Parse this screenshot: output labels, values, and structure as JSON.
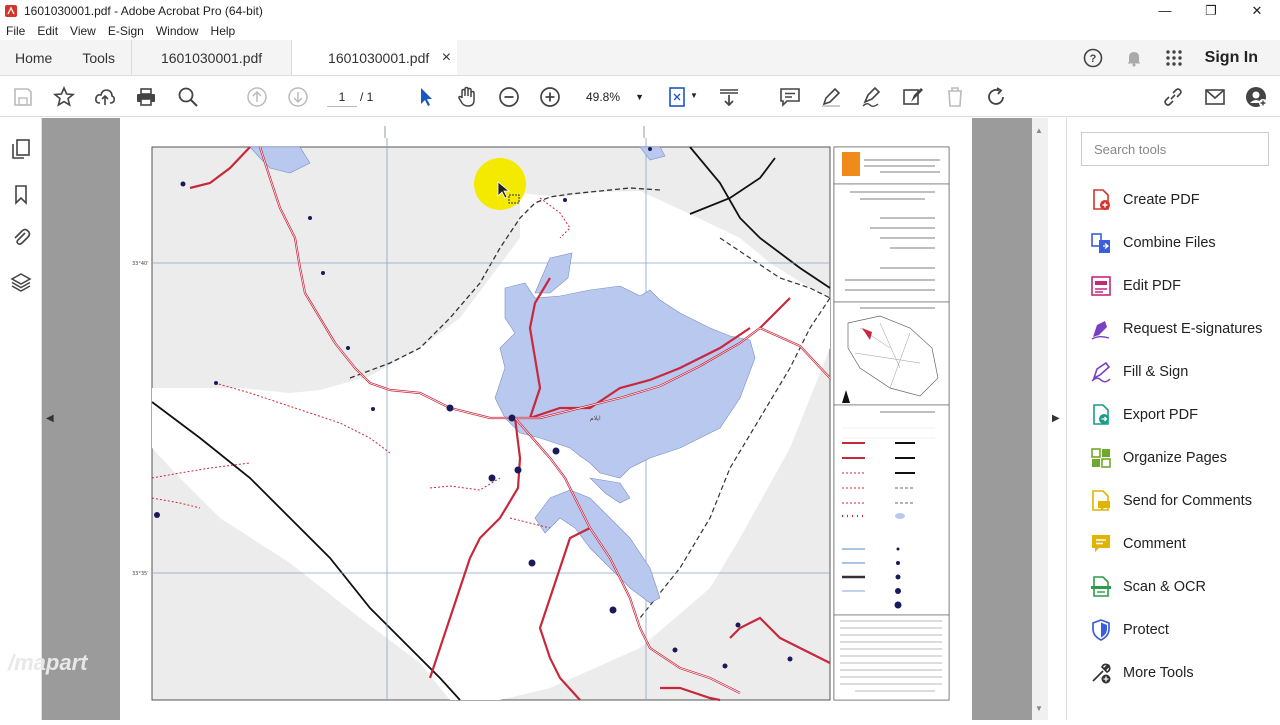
{
  "window": {
    "title": "1601030001.pdf - Adobe Acrobat Pro (64-bit)",
    "controls": [
      "—",
      "❐",
      "✕"
    ]
  },
  "menu": [
    "File",
    "Edit",
    "View",
    "E-Sign",
    "Window",
    "Help"
  ],
  "tabs": {
    "home": "Home",
    "tools": "Tools",
    "doc1": "1601030001.pdf",
    "doc2": "1601030001.pdf",
    "close": "×",
    "signin": "Sign In"
  },
  "toolbar": {
    "page_current": "1",
    "page_total": "/  1",
    "zoom": "49.8%"
  },
  "right_panel": {
    "search_placeholder": "Search tools",
    "tools": [
      {
        "label": "Create PDF",
        "color": "#d4342c",
        "icon": "create-pdf-icon"
      },
      {
        "label": "Combine Files",
        "color": "#3b5fd9",
        "icon": "combine-files-icon"
      },
      {
        "label": "Edit PDF",
        "color": "#c4287a",
        "icon": "edit-pdf-icon"
      },
      {
        "label": "Request E-signatures",
        "color": "#7b3fc4",
        "icon": "request-esign-icon"
      },
      {
        "label": "Fill & Sign",
        "color": "#7b3fc4",
        "icon": "fill-sign-icon"
      },
      {
        "label": "Export PDF",
        "color": "#1b9a8a",
        "icon": "export-pdf-icon"
      },
      {
        "label": "Organize Pages",
        "color": "#6fa82c",
        "icon": "organize-pages-icon"
      },
      {
        "label": "Send for Comments",
        "color": "#e0b400",
        "icon": "send-comments-icon"
      },
      {
        "label": "Comment",
        "color": "#e0b400",
        "icon": "comment-icon"
      },
      {
        "label": "Scan & OCR",
        "color": "#2d9b4a",
        "icon": "scan-ocr-icon"
      },
      {
        "label": "Protect",
        "color": "#3b5fd9",
        "icon": "protect-icon"
      },
      {
        "label": "More Tools",
        "color": "#333333",
        "icon": "more-tools-icon"
      }
    ]
  },
  "map": {
    "place_ilam": "ایلام",
    "coord_1": "33°40'",
    "coord_2": "33°35'"
  },
  "watermark": "/mapart"
}
